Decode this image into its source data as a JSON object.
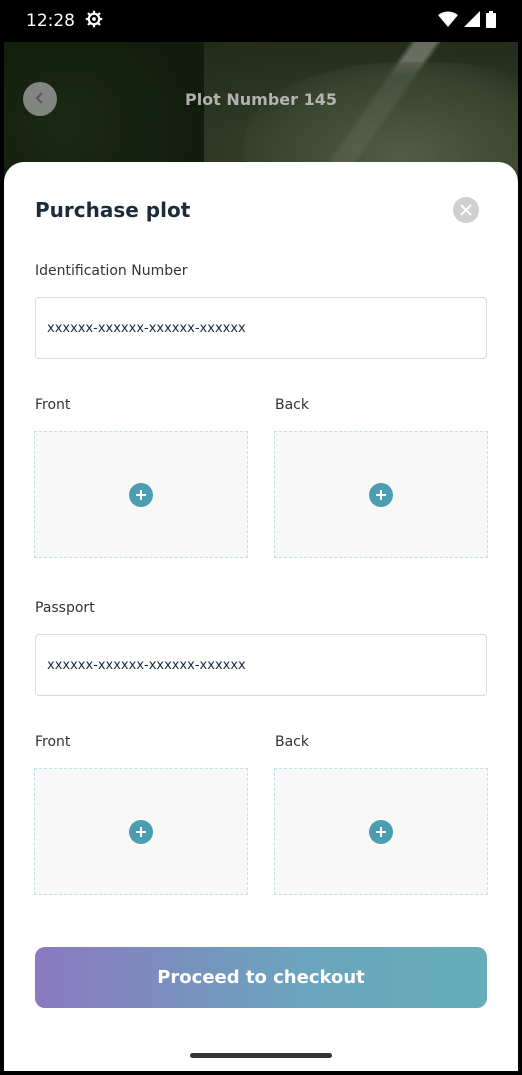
{
  "status_bar": {
    "time": "12:28"
  },
  "header": {
    "title": "Plot Number 145"
  },
  "sheet": {
    "title": "Purchase plot",
    "identification": {
      "label": "Identification Number",
      "value": "xxxxxx-xxxxxx-xxxxxx-xxxxxx",
      "front_label": "Front",
      "back_label": "Back"
    },
    "passport": {
      "label": "Passport",
      "value": "xxxxxx-xxxxxx-xxxxxx-xxxxxx",
      "front_label": "Front",
      "back_label": "Back"
    },
    "checkout_label": "Proceed to checkout"
  },
  "colors": {
    "accent": "#4a9eb0",
    "gradient_start": "#8a79c0",
    "gradient_end": "#66adb8",
    "title": "#1c2b3a"
  }
}
